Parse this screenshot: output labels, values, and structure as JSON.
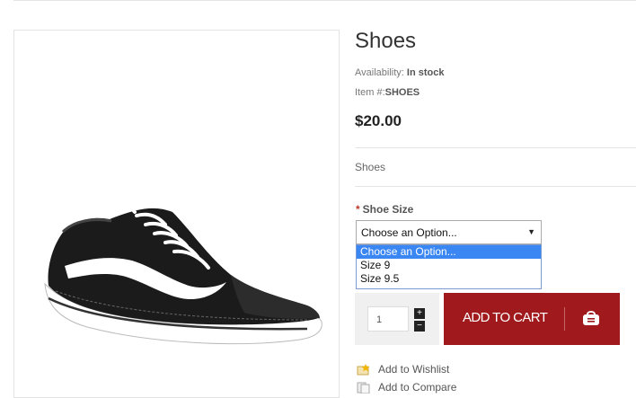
{
  "product": {
    "title": "Shoes",
    "availability_label": "Availability:",
    "availability_value": "In stock",
    "item_label": "Item #:",
    "item_value": "SHOES",
    "price": "$20.00",
    "short_description": "Shoes"
  },
  "options": {
    "required_mark": "*",
    "size_label": "Shoe Size",
    "selected": "Choose an Option...",
    "choices": [
      "Choose an Option...",
      "Size 9",
      "Size 9.5"
    ]
  },
  "cart": {
    "quantity": "1",
    "plus": "+",
    "minus": "−",
    "add_label": "ADD TO CART"
  },
  "links": {
    "wishlist": "Add to Wishlist",
    "compare": "Add to Compare"
  },
  "colors": {
    "accent": "#a01a1d",
    "dropdown_highlight": "#3a86f3"
  }
}
